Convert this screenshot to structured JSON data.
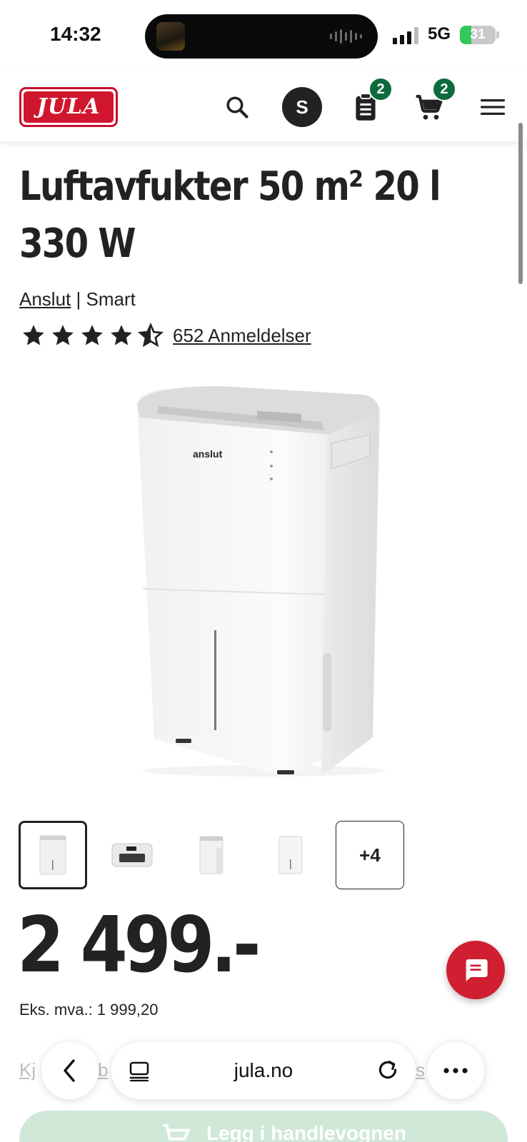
{
  "status_bar": {
    "time": "14:32",
    "network": "5G",
    "battery_level": "31",
    "battery_fraction": 0.31
  },
  "header": {
    "logo_text": "JULA",
    "avatar_initial": "S",
    "list_badge": "2",
    "cart_badge": "2",
    "icons": [
      "search-icon",
      "list-icon",
      "cart-icon",
      "menu-icon"
    ]
  },
  "product": {
    "title": "Luftavfukter 50 m² 20 l 330 W",
    "brand": "Anslut",
    "brand_separator": "|",
    "line": "Smart",
    "rating": 4.5,
    "reviews": "652 Anmeldelser",
    "product_logo": "anslut",
    "thumbnails_more": "+4",
    "price": "2 499.-",
    "ex_vat": "Eks. mva.: 1 999,20"
  },
  "colors": {
    "brand_red": "#cf1f31",
    "badge_green": "#0c6b3a",
    "text_dark": "#222222"
  },
  "browser": {
    "url": "jula.no",
    "back_icon": "chevron-left-icon",
    "tabs_icon": "tabs-icon",
    "reload_icon": "reload-icon",
    "more_icon": "more-icon"
  },
  "partial": {
    "left_link": "Kj",
    "mid_link": "b",
    "right_link": "s",
    "cart_button_label": "Legg i handlevognen"
  }
}
